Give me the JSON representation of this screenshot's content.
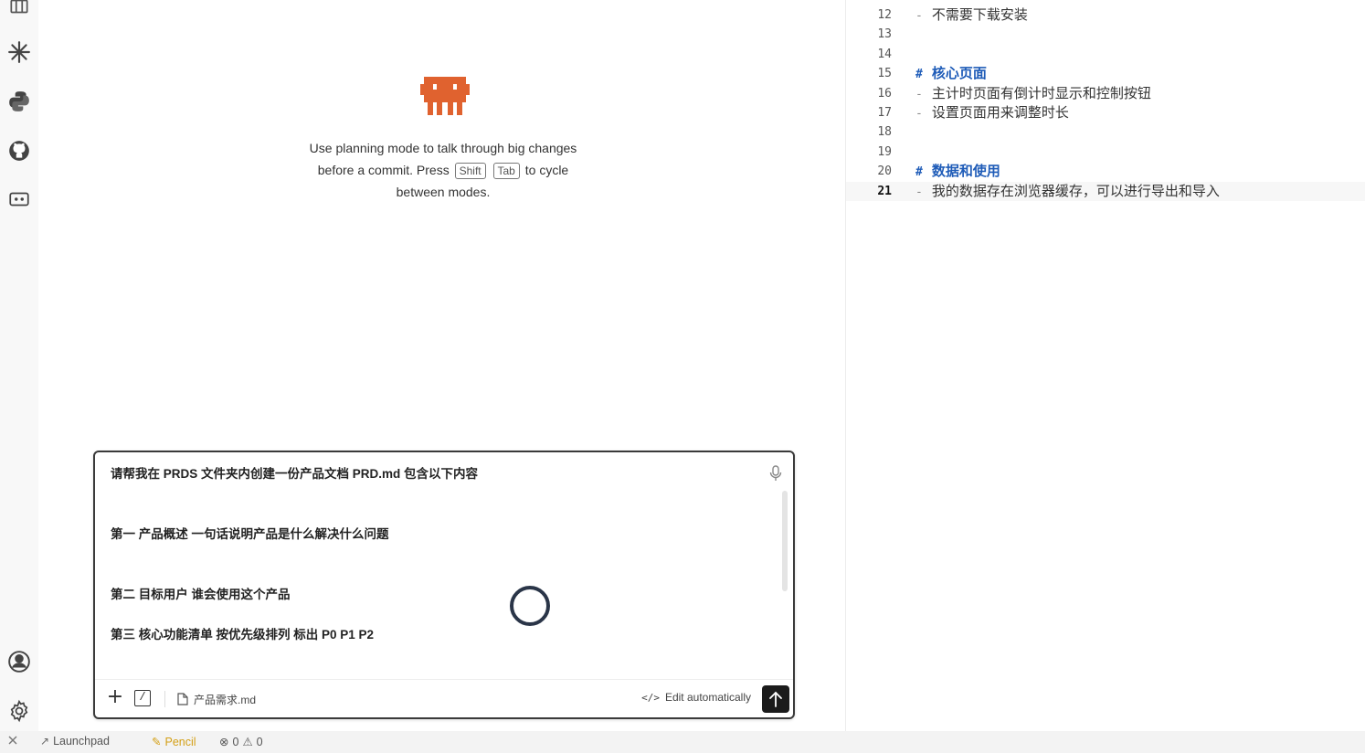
{
  "chat": {
    "hint_line1": "Use planning mode to talk through big changes",
    "hint_line2_before": "before a commit. Press",
    "key_shift": "Shift",
    "key_tab": "Tab",
    "hint_line2_after": "to cycle",
    "hint_line3": "between modes.",
    "prompt_lines": [
      "请帮我在 PRDS 文件夹内创建一份产品文档 PRD.md 包含以下内容",
      "第一 产品概述 一句话说明产品是什么解决什么问题",
      "第二 目标用户 谁会使用这个产品",
      "第三 核心功能清单 按优先级排列 标出 P0 P1 P2"
    ],
    "attached_file": "产品需求.md",
    "edit_mode_label": "Edit automatically",
    "plus_label": "+",
    "slash_label": "/"
  },
  "editor": {
    "lines": [
      {
        "num": "12",
        "mark": "-",
        "text": "不需要下载安装",
        "heading": false
      },
      {
        "num": "13",
        "mark": "",
        "text": "",
        "heading": false
      },
      {
        "num": "14",
        "mark": "",
        "text": "",
        "heading": false
      },
      {
        "num": "15",
        "mark": "#",
        "text": "核心页面",
        "heading": true
      },
      {
        "num": "16",
        "mark": "-",
        "text": "主计时页面有倒计时显示和控制按钮",
        "heading": false
      },
      {
        "num": "17",
        "mark": "-",
        "text": "设置页面用来调整时长",
        "heading": false
      },
      {
        "num": "18",
        "mark": "",
        "text": "",
        "heading": false
      },
      {
        "num": "19",
        "mark": "",
        "text": "",
        "heading": false
      },
      {
        "num": "20",
        "mark": "#",
        "text": "数据和使用",
        "heading": true
      },
      {
        "num": "21",
        "mark": "-",
        "text": "我的数据存在浏览器缓存，可以进行导出和导入",
        "heading": false
      }
    ],
    "current_line": "21"
  },
  "status_bar": {
    "launchpad": "Launchpad",
    "pencil": "Pencil",
    "errors": "0",
    "warnings": "0"
  },
  "colors": {
    "heading": "#1f5cb8",
    "pencil": "#d4a017",
    "send_button": "#1b1b1b",
    "mascot": "#e0622f"
  },
  "icons": [
    "package-icon",
    "sparkle-icon",
    "python-icon",
    "github-icon",
    "remote-icon",
    "account-icon",
    "settings-gear-icon",
    "close-x-icon",
    "rocket-icon",
    "pencil-icon",
    "error-icon",
    "warning-icon",
    "microphone-icon",
    "file-icon",
    "code-icon",
    "arrow-up-icon"
  ]
}
